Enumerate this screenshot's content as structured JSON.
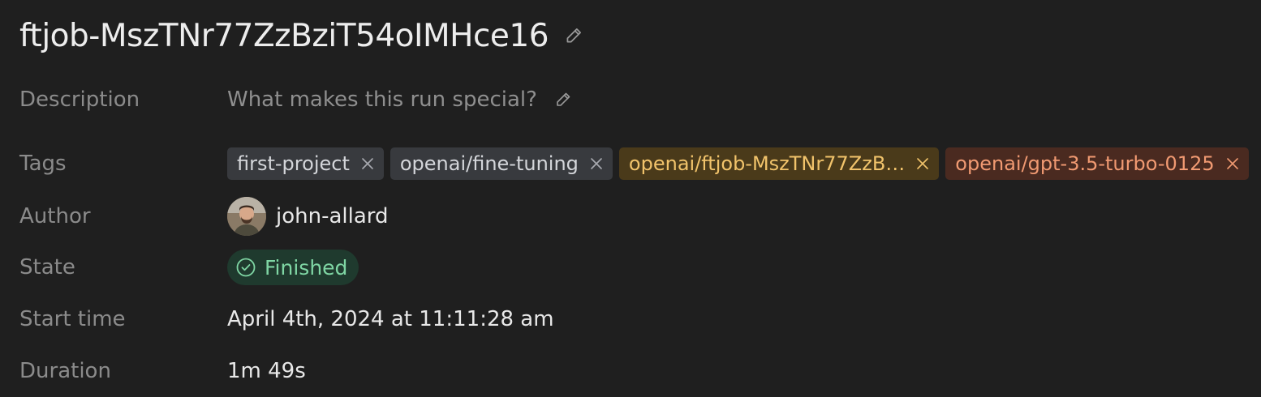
{
  "run": {
    "title": "ftjob-MszTNr77ZzBziT54oIMHce16"
  },
  "fields": {
    "description": {
      "label": "Description",
      "placeholder": "What makes this run special?"
    },
    "tags": {
      "label": "Tags",
      "items": [
        {
          "text": "first-project",
          "color": "#383a3e"
        },
        {
          "text": "openai/fine-tuning",
          "color": "#383a3e"
        },
        {
          "text": "openai/ftjob-MszTNr77ZzB…",
          "color": "#4a3a1a"
        },
        {
          "text": "openai/gpt-3.5-turbo-0125",
          "color": "#4a2a20"
        }
      ]
    },
    "author": {
      "label": "Author",
      "name": "john-allard"
    },
    "state": {
      "label": "State",
      "value": "Finished",
      "color": "#7fd6a4"
    },
    "start_time": {
      "label": "Start time",
      "value": "April 4th, 2024 at 11:11:28 am"
    },
    "duration": {
      "label": "Duration",
      "value": "1m 49s"
    }
  },
  "icons": {
    "title_edit": "pencil-icon",
    "description_edit": "pencil-icon",
    "tag_remove": "close-icon",
    "state": "check-circle-icon"
  }
}
